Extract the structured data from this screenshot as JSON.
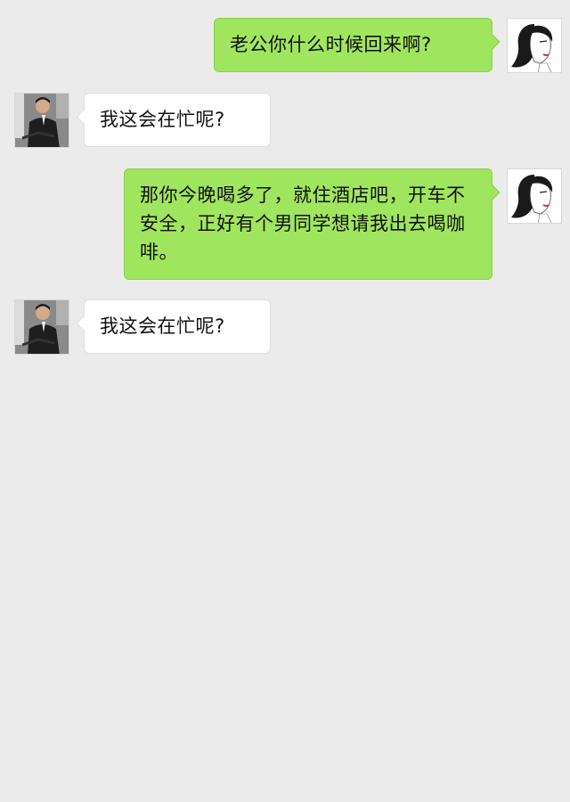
{
  "messages": [
    {
      "sender": "self",
      "avatar_icon": "woman-avatar-icon",
      "text": "老公你什么时候回来啊?"
    },
    {
      "sender": "other",
      "avatar_icon": "man-avatar-icon",
      "text": "我这会在忙呢?"
    },
    {
      "sender": "self",
      "avatar_icon": "woman-avatar-icon",
      "text": "那你今晚喝多了，就住酒店吧，开车不安全，正好有个男同学想请我出去喝咖啡。"
    },
    {
      "sender": "other",
      "avatar_icon": "man-avatar-icon",
      "text": "我这会在忙呢?"
    }
  ],
  "colors": {
    "background": "#ebebeb",
    "outgoing_bubble": "#9fe65e",
    "incoming_bubble": "#ffffff"
  }
}
